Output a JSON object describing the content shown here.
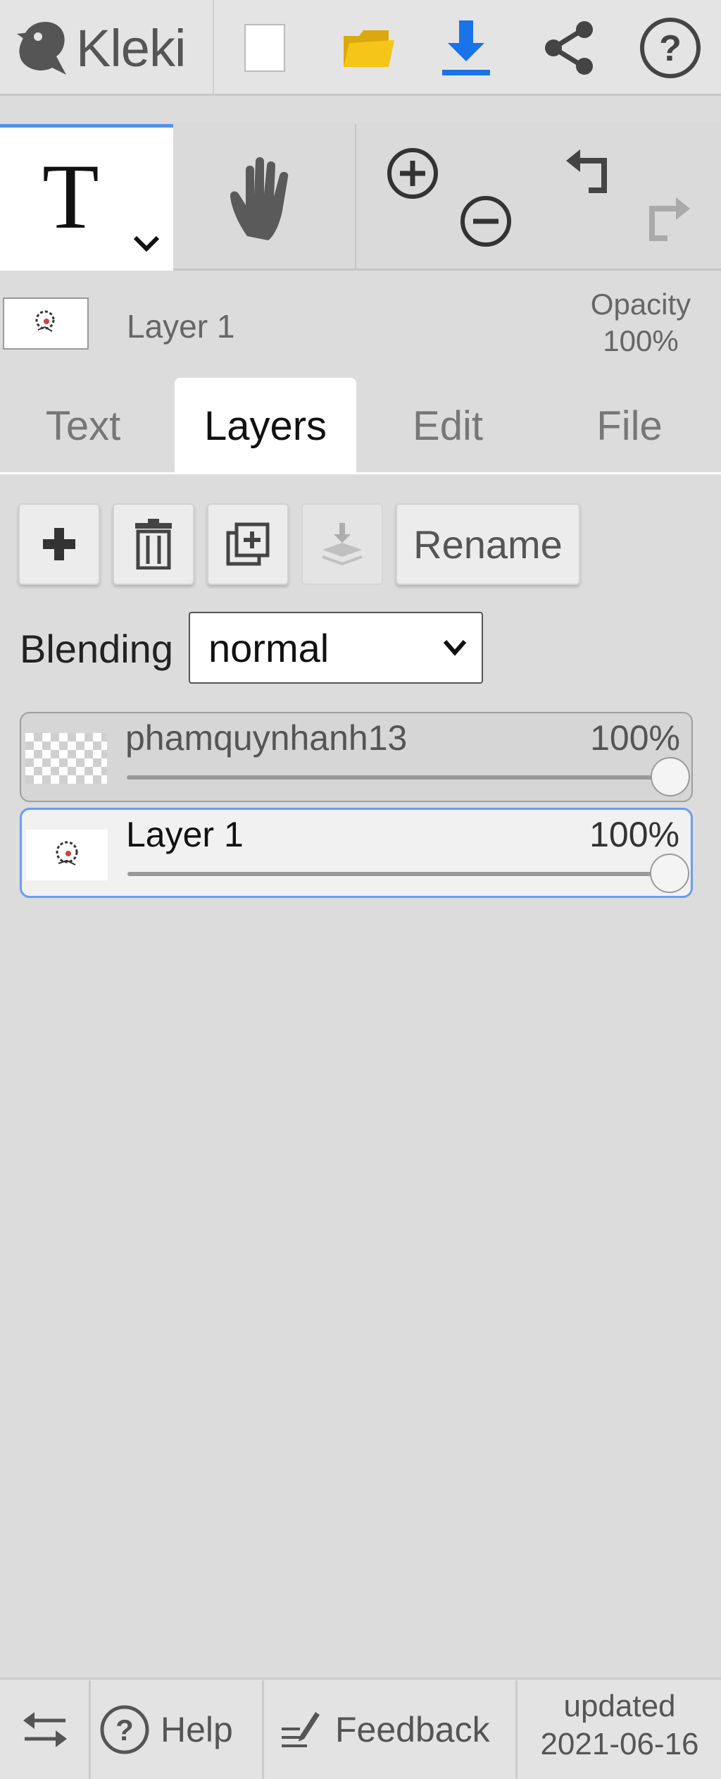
{
  "app": {
    "logo_text": "Kleki",
    "brand_colors": {
      "accent": "#4f93f2",
      "download": "#1a73e8",
      "folder": "#f5c518"
    }
  },
  "toolbar": {
    "icons": [
      "new-image-icon",
      "open-folder-icon",
      "download-icon",
      "share-icon",
      "help-icon"
    ]
  },
  "tools": {
    "active_tool_glyph": "T",
    "icons": [
      "text-tool-icon",
      "hand-tool-icon",
      "zoom-in-icon",
      "zoom-out-icon",
      "undo-icon",
      "redo-icon"
    ]
  },
  "current_layer": {
    "name": "Layer 1",
    "opacity_label": "Opacity",
    "opacity_value": "100%"
  },
  "tabs": [
    {
      "label": "Text",
      "active": false
    },
    {
      "label": "Layers",
      "active": true
    },
    {
      "label": "Edit",
      "active": false
    },
    {
      "label": "File",
      "active": false
    }
  ],
  "layer_actions": {
    "rename_label": "Rename",
    "icons": [
      "add-layer-icon",
      "delete-layer-icon",
      "duplicate-layer-icon",
      "merge-down-icon"
    ]
  },
  "blending": {
    "label": "Blending",
    "value": "normal"
  },
  "layers": [
    {
      "name": "phamquynhanh13",
      "opacity": "100%",
      "opacity_fraction": 1.0,
      "selected": false
    },
    {
      "name": "Layer 1",
      "opacity": "100%",
      "opacity_fraction": 1.0,
      "selected": true
    }
  ],
  "footer": {
    "help_label": "Help",
    "feedback_label": "Feedback",
    "updated_label": "updated",
    "updated_date": "2021-06-16"
  }
}
